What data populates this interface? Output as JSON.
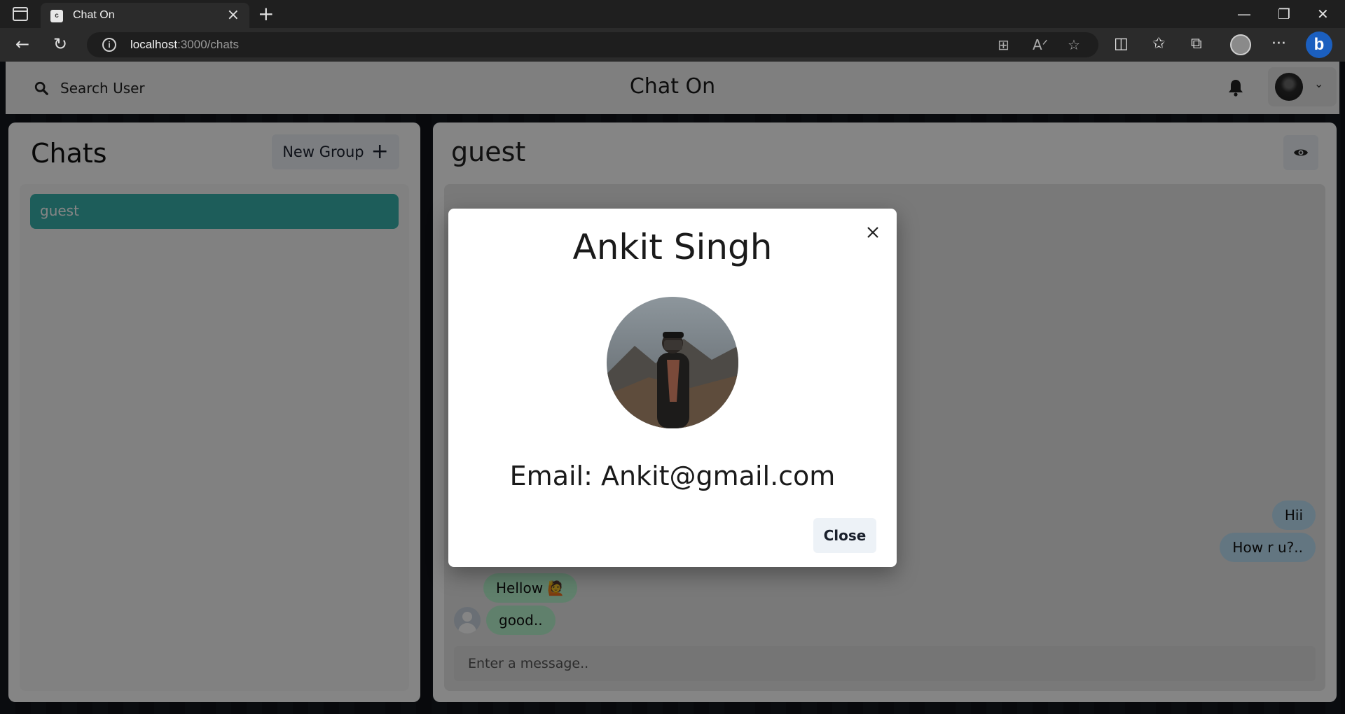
{
  "browser": {
    "tab_title": "Chat On",
    "tab_favicon_letter": "c",
    "url_host": "localhost",
    "url_path": ":3000/chats",
    "icons": [
      "sidebar-toggle-icon",
      "close-icon",
      "plus-icon",
      "minimize-icon",
      "restore-icon",
      "close-window-icon",
      "back-arrow-icon",
      "refresh-icon",
      "info-icon",
      "app-available-icon",
      "read-aloud-icon",
      "favorite-star-icon",
      "split-screen-icon",
      "favorites-icon",
      "collections-icon",
      "profile-icon",
      "more-icon",
      "bing-icon"
    ]
  },
  "header": {
    "search_label": "Search User",
    "app_title": "Chat On"
  },
  "chats_panel": {
    "title": "Chats",
    "new_group_label": "New Group",
    "items": [
      {
        "label": "guest",
        "selected": true
      }
    ]
  },
  "conversation": {
    "name": "guest",
    "messages": [
      {
        "text": "Hii",
        "side": "sent"
      },
      {
        "text": "How r u?..",
        "side": "sent"
      },
      {
        "text": "Hellow 🙋",
        "side": "received"
      },
      {
        "text": "good..",
        "side": "received"
      }
    ],
    "input_placeholder": "Enter a message.."
  },
  "modal": {
    "title": "Ankit Singh",
    "email": "Email: Ankit@gmail.com",
    "close_label": "Close"
  },
  "colors": {
    "selected_chat": "#38b2ac",
    "sent_bubble": "#bee3f8",
    "received_bubble": "#b9f5d0",
    "button_bg": "#edf2f7"
  }
}
